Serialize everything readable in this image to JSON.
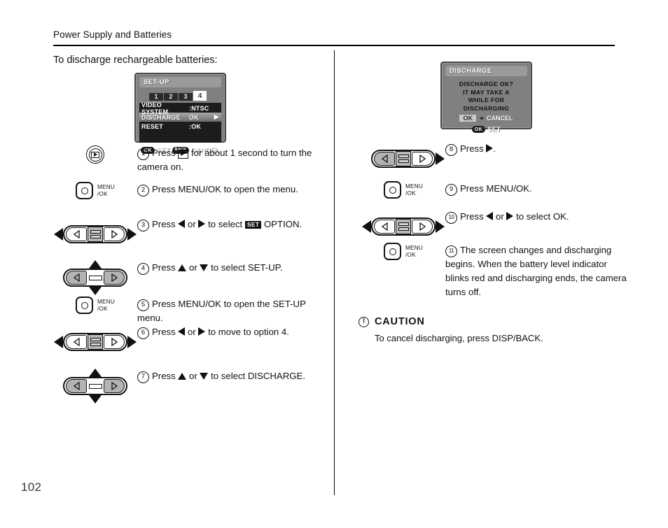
{
  "header": {
    "title": "Power Supply and Batteries"
  },
  "page": {
    "number": "102"
  },
  "intro": {
    "text": "To discharge rechargeable batteries:"
  },
  "setup_screen": {
    "title": "SET-UP",
    "tabs": [
      "1",
      "2",
      "3",
      "4"
    ],
    "active_tab": "4",
    "rows": [
      {
        "label": "VIDEO SYSTEM",
        "value": ":NTSC",
        "highlighted": false,
        "arrow": ""
      },
      {
        "label": "DISCHARGE",
        "value": "OK",
        "highlighted": true,
        "arrow": "▶"
      },
      {
        "label": "RESET",
        "value": ":OK",
        "highlighted": false,
        "arrow": ""
      }
    ],
    "footer": {
      "ok_pill": "OK",
      "ok_text": "SET",
      "back_pill": "BACK",
      "back_text": "CANCEL"
    }
  },
  "discharge_screen": {
    "title": "DISCHARGE",
    "message_lines": [
      "DISCHARGE OK?",
      "IT  MAY  TAKE  A",
      "WHILE FOR",
      "DISCHARGING"
    ],
    "choice": {
      "ok": "OK",
      "lr": "◂▸",
      "cancel": "CANCEL"
    },
    "footer": {
      "ok_pill": "OK",
      "ok_text": "SET"
    }
  },
  "steps_left": [
    {
      "num": "1",
      "art": "playback-button",
      "text_parts": [
        "Press ",
        "[PLAY]",
        " for about 1 second to turn the camera on."
      ]
    },
    {
      "num": "2",
      "art": "menu-ok-button",
      "text": "Press MENU/OK to open the menu."
    },
    {
      "num": "3",
      "art": "dpad-horizontal-white-both",
      "text_parts": [
        "Press ",
        "◀",
        " or ",
        "▶",
        " to select ",
        "SET",
        " OPTION."
      ]
    },
    {
      "num": "4",
      "art": "dpad-vertical-gray-both",
      "text_parts": [
        "Press ",
        "▲",
        " or ",
        "▼",
        " to select SET-UP."
      ]
    },
    {
      "num": "5",
      "art": "menu-ok-button",
      "text": "Press MENU/OK to open the SET-UP menu."
    },
    {
      "num": "6",
      "art": "dpad-horizontal-white-both",
      "text_parts": [
        "Press ",
        "◀",
        " or ",
        "▶",
        " to move to option 4."
      ]
    },
    {
      "num": "7",
      "art": "dpad-vertical-gray-both",
      "text_parts": [
        "Press ",
        "▲",
        " or ",
        "▼",
        " to select DISCHARGE."
      ]
    }
  ],
  "steps_right": [
    {
      "num": "8",
      "art": "dpad-horizontal-grayleft-right-only",
      "text_parts": [
        "Press ",
        "▶",
        "."
      ]
    },
    {
      "num": "9",
      "art": "menu-ok-button",
      "text": "Press MENU/OK."
    },
    {
      "num": "10",
      "art": "dpad-horizontal-white-both",
      "text_parts": [
        "Press ",
        "◀",
        " or ",
        "▶",
        " to select OK."
      ]
    },
    {
      "num": "11",
      "art": "menu-ok-button",
      "text": "The screen changes and discharging begins. When the battery level indicator blinks red and discharging ends, the camera turns off."
    }
  ],
  "menu_ok_label": {
    "line1": "MENU",
    "line2": "/OK"
  },
  "caution": {
    "icon": "!",
    "title": "CAUTION",
    "body": "To cancel discharging, press DISP/BACK."
  },
  "colors": {
    "lcd_bg": "#808080",
    "lcd_menu_bg": "#1c1c1c",
    "lcd_title_bg": "#9a9a9a",
    "ink": "#111111",
    "pad_gray": "#b3b3b3"
  }
}
